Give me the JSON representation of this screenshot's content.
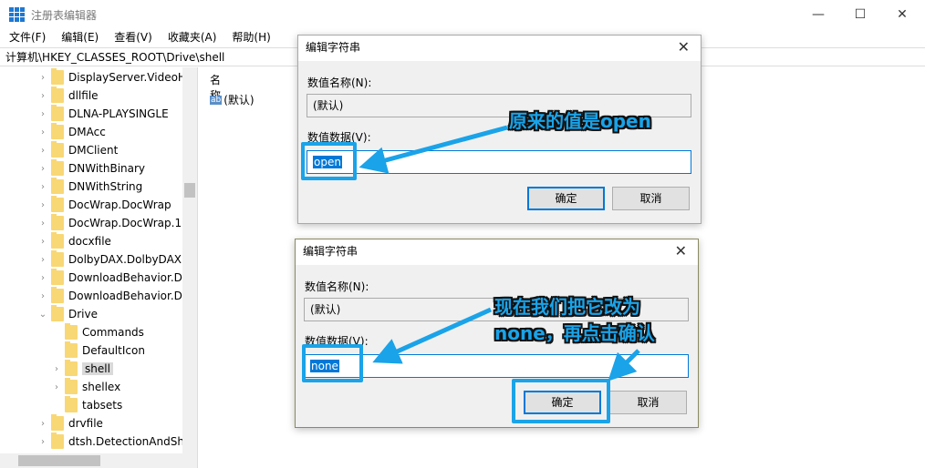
{
  "window": {
    "title": "注册表编辑器",
    "minimize": "—",
    "maximize": "☐",
    "close": "✕"
  },
  "menu": [
    "文件(F)",
    "编辑(E)",
    "查看(V)",
    "收藏夹(A)",
    "帮助(H)"
  ],
  "address": "计算机\\HKEY_CLASSES_ROOT\\Drive\\shell",
  "tree": [
    {
      "label": "DisplayServer.VideoH",
      "level": 0,
      "arrow": "›"
    },
    {
      "label": "dllfile",
      "level": 0,
      "arrow": "›"
    },
    {
      "label": "DLNA-PLAYSINGLE",
      "level": 0,
      "arrow": "›"
    },
    {
      "label": "DMAcc",
      "level": 0,
      "arrow": "›"
    },
    {
      "label": "DMClient",
      "level": 0,
      "arrow": "›"
    },
    {
      "label": "DNWithBinary",
      "level": 0,
      "arrow": "›"
    },
    {
      "label": "DNWithString",
      "level": 0,
      "arrow": "›"
    },
    {
      "label": "DocWrap.DocWrap",
      "level": 0,
      "arrow": "›"
    },
    {
      "label": "DocWrap.DocWrap.1",
      "level": 0,
      "arrow": "›"
    },
    {
      "label": "docxfile",
      "level": 0,
      "arrow": "›"
    },
    {
      "label": "DolbyDAX.DolbyDAX",
      "level": 0,
      "arrow": "›"
    },
    {
      "label": "DownloadBehavior.Do",
      "level": 0,
      "arrow": "›"
    },
    {
      "label": "DownloadBehavior.D",
      "level": 0,
      "arrow": "›"
    },
    {
      "label": "Drive",
      "level": 0,
      "arrow": "⌄"
    },
    {
      "label": "Commands",
      "level": 1,
      "arrow": ""
    },
    {
      "label": "DefaultIcon",
      "level": 1,
      "arrow": ""
    },
    {
      "label": "shell",
      "level": 1,
      "arrow": "›",
      "selected": true
    },
    {
      "label": "shellex",
      "level": 1,
      "arrow": "›"
    },
    {
      "label": "tabsets",
      "level": 1,
      "arrow": ""
    },
    {
      "label": "drvfile",
      "level": 0,
      "arrow": "›"
    },
    {
      "label": "dtsh.DetectionAndSha",
      "level": 0,
      "arrow": "›"
    }
  ],
  "list": {
    "header": "名称",
    "items": [
      {
        "icon": "ab",
        "name": "(默认)"
      }
    ]
  },
  "dialog1": {
    "title": "编辑字符串",
    "name_label": "数值名称(N):",
    "name_value": "(默认)",
    "data_label": "数值数据(V):",
    "data_value": "open",
    "ok": "确定",
    "cancel": "取消"
  },
  "dialog2": {
    "title": "编辑字符串",
    "name_label": "数值名称(N):",
    "name_value": "(默认)",
    "data_label": "数值数据(V):",
    "data_value": "none",
    "ok": "确定",
    "cancel": "取消"
  },
  "annotations": {
    "note1": "原来的值是open",
    "note2_line1": "现在我们把它改为",
    "note2_line2": "none，再点击确认",
    "color": "#1aa3e8"
  }
}
